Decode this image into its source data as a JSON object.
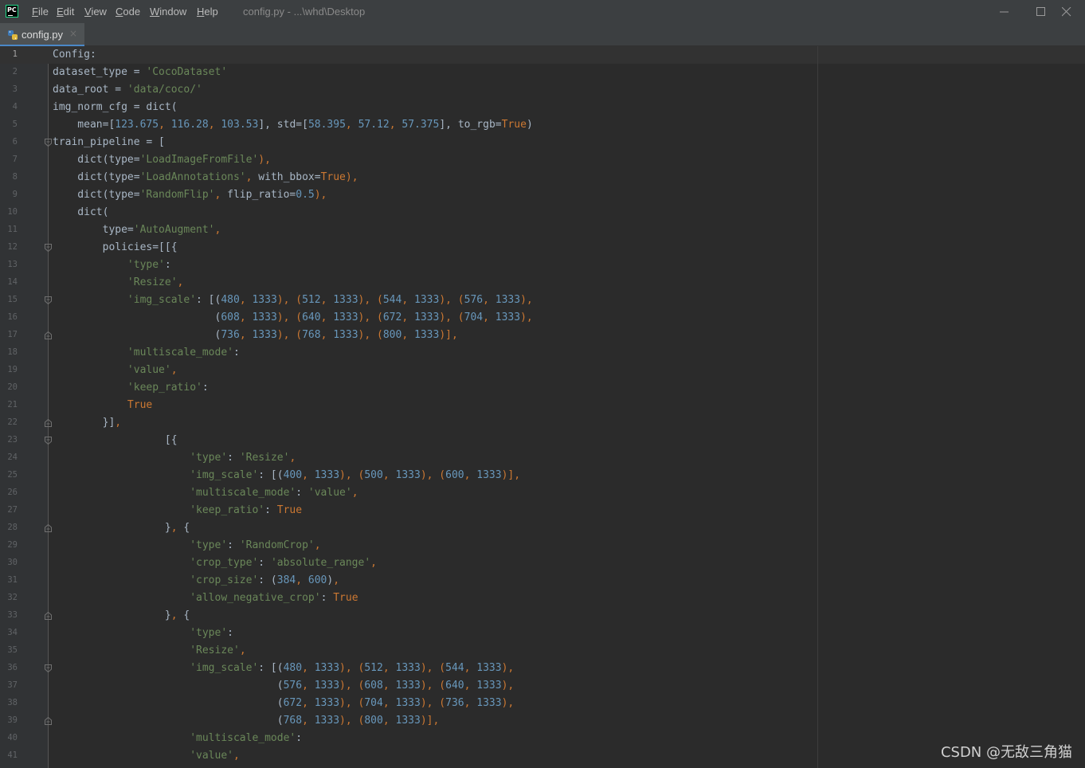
{
  "app": {
    "logo_text": "PC",
    "menu": [
      {
        "prefix": "",
        "accel": "F",
        "rest": "ile"
      },
      {
        "prefix": "",
        "accel": "E",
        "rest": "dit"
      },
      {
        "prefix": "",
        "accel": "V",
        "rest": "iew"
      },
      {
        "prefix": "",
        "accel": "C",
        "rest": "ode"
      },
      {
        "prefix": "",
        "accel": "W",
        "rest": "indow"
      },
      {
        "prefix": "",
        "accel": "H",
        "rest": "elp"
      }
    ],
    "window_title": "config.py - ...\\whd\\Desktop"
  },
  "tab": {
    "label": "config.py",
    "close_glyph": "×"
  },
  "editor": {
    "current_line": 1,
    "lines": [
      {
        "n": "1",
        "fold": "",
        "tokens": [
          [
            "Config:",
            ""
          ]
        ]
      },
      {
        "n": "2",
        "fold": "",
        "tokens": [
          [
            "dataset_type = ",
            ""
          ],
          [
            "'CocoDataset'",
            "s"
          ]
        ]
      },
      {
        "n": "3",
        "fold": "",
        "tokens": [
          [
            "data_root = ",
            ""
          ],
          [
            "'data/coco/'",
            "s"
          ]
        ]
      },
      {
        "n": "4",
        "fold": "",
        "tokens": [
          [
            "img_norm_cfg = dict(",
            ""
          ]
        ]
      },
      {
        "n": "5",
        "fold": "",
        "tokens": [
          [
            "    mean=[",
            ""
          ],
          [
            "123.675",
            "n"
          ],
          [
            ", ",
            "p"
          ],
          [
            "116.28",
            "n"
          ],
          [
            ", ",
            "p"
          ],
          [
            "103.53",
            "n"
          ],
          [
            "], std=[",
            ""
          ],
          [
            "58.395",
            "n"
          ],
          [
            ", ",
            "p"
          ],
          [
            "57.12",
            "n"
          ],
          [
            ", ",
            "p"
          ],
          [
            "57.375",
            "n"
          ],
          [
            "], to_rgb=",
            ""
          ],
          [
            "True",
            "k"
          ],
          [
            ")",
            ""
          ]
        ]
      },
      {
        "n": "6",
        "fold": "open",
        "tokens": [
          [
            "train_pipeline = [",
            ""
          ]
        ]
      },
      {
        "n": "7",
        "fold": "",
        "tokens": [
          [
            "    dict(type=",
            ""
          ],
          [
            "'LoadImageFromFile'",
            "s"
          ],
          [
            "),",
            "p"
          ]
        ]
      },
      {
        "n": "8",
        "fold": "",
        "tokens": [
          [
            "    dict(type=",
            ""
          ],
          [
            "'LoadAnnotations'",
            "s"
          ],
          [
            ", ",
            "p"
          ],
          [
            "with_bbox=",
            ""
          ],
          [
            "True",
            "k"
          ],
          [
            "),",
            "p"
          ]
        ]
      },
      {
        "n": "9",
        "fold": "",
        "tokens": [
          [
            "    dict(type=",
            ""
          ],
          [
            "'RandomFlip'",
            "s"
          ],
          [
            ", ",
            "p"
          ],
          [
            "flip_ratio=",
            ""
          ],
          [
            "0.5",
            "n"
          ],
          [
            "),",
            "p"
          ]
        ]
      },
      {
        "n": "10",
        "fold": "",
        "tokens": [
          [
            "    dict(",
            ""
          ]
        ]
      },
      {
        "n": "11",
        "fold": "",
        "tokens": [
          [
            "        type=",
            ""
          ],
          [
            "'AutoAugment'",
            "s"
          ],
          [
            ",",
            "p"
          ]
        ]
      },
      {
        "n": "12",
        "fold": "open",
        "tokens": [
          [
            "        policies=[[{",
            ""
          ]
        ]
      },
      {
        "n": "13",
        "fold": "",
        "tokens": [
          [
            "            ",
            ""
          ],
          [
            "'type'",
            "s"
          ],
          [
            ":",
            ""
          ]
        ]
      },
      {
        "n": "14",
        "fold": "",
        "tokens": [
          [
            "            ",
            ""
          ],
          [
            "'Resize'",
            "s"
          ],
          [
            ",",
            "p"
          ]
        ]
      },
      {
        "n": "15",
        "fold": "open",
        "tokens": [
          [
            "            ",
            ""
          ],
          [
            "'img_scale'",
            "s"
          ],
          [
            ": [(",
            ""
          ],
          [
            "480",
            "n"
          ],
          [
            ", ",
            "p"
          ],
          [
            "1333",
            "n"
          ],
          [
            "), (",
            "p"
          ],
          [
            "512",
            "n"
          ],
          [
            ", ",
            "p"
          ],
          [
            "1333",
            "n"
          ],
          [
            "), (",
            "p"
          ],
          [
            "544",
            "n"
          ],
          [
            ", ",
            "p"
          ],
          [
            "1333",
            "n"
          ],
          [
            "), (",
            "p"
          ],
          [
            "576",
            "n"
          ],
          [
            ", ",
            "p"
          ],
          [
            "1333",
            "n"
          ],
          [
            "),",
            "p"
          ]
        ]
      },
      {
        "n": "16",
        "fold": "",
        "tokens": [
          [
            "                          (",
            ""
          ],
          [
            "608",
            "n"
          ],
          [
            ", ",
            "p"
          ],
          [
            "1333",
            "n"
          ],
          [
            "), (",
            "p"
          ],
          [
            "640",
            "n"
          ],
          [
            ", ",
            "p"
          ],
          [
            "1333",
            "n"
          ],
          [
            "), (",
            "p"
          ],
          [
            "672",
            "n"
          ],
          [
            ", ",
            "p"
          ],
          [
            "1333",
            "n"
          ],
          [
            "), (",
            "p"
          ],
          [
            "704",
            "n"
          ],
          [
            ", ",
            "p"
          ],
          [
            "1333",
            "n"
          ],
          [
            "),",
            "p"
          ]
        ]
      },
      {
        "n": "17",
        "fold": "close",
        "tokens": [
          [
            "                          (",
            ""
          ],
          [
            "736",
            "n"
          ],
          [
            ", ",
            "p"
          ],
          [
            "1333",
            "n"
          ],
          [
            "), (",
            "p"
          ],
          [
            "768",
            "n"
          ],
          [
            ", ",
            "p"
          ],
          [
            "1333",
            "n"
          ],
          [
            "), (",
            "p"
          ],
          [
            "800",
            "n"
          ],
          [
            ", ",
            "p"
          ],
          [
            "1333",
            "n"
          ],
          [
            ")],",
            "p"
          ]
        ]
      },
      {
        "n": "18",
        "fold": "",
        "tokens": [
          [
            "            ",
            ""
          ],
          [
            "'multiscale_mode'",
            "s"
          ],
          [
            ":",
            ""
          ]
        ]
      },
      {
        "n": "19",
        "fold": "",
        "tokens": [
          [
            "            ",
            ""
          ],
          [
            "'value'",
            "s"
          ],
          [
            ",",
            "p"
          ]
        ]
      },
      {
        "n": "20",
        "fold": "",
        "tokens": [
          [
            "            ",
            ""
          ],
          [
            "'keep_ratio'",
            "s"
          ],
          [
            ":",
            ""
          ]
        ]
      },
      {
        "n": "21",
        "fold": "",
        "tokens": [
          [
            "            ",
            ""
          ],
          [
            "True",
            "k"
          ]
        ]
      },
      {
        "n": "22",
        "fold": "close",
        "tokens": [
          [
            "        }]",
            ""
          ],
          [
            ",",
            "p"
          ]
        ]
      },
      {
        "n": "23",
        "fold": "open",
        "tokens": [
          [
            "                  [{",
            ""
          ]
        ]
      },
      {
        "n": "24",
        "fold": "",
        "tokens": [
          [
            "                      ",
            ""
          ],
          [
            "'type'",
            "s"
          ],
          [
            ": ",
            ""
          ],
          [
            "'Resize'",
            "s"
          ],
          [
            ",",
            "p"
          ]
        ]
      },
      {
        "n": "25",
        "fold": "",
        "tokens": [
          [
            "                      ",
            ""
          ],
          [
            "'img_scale'",
            "s"
          ],
          [
            ": [(",
            ""
          ],
          [
            "400",
            "n"
          ],
          [
            ", ",
            "p"
          ],
          [
            "1333",
            "n"
          ],
          [
            "), (",
            "p"
          ],
          [
            "500",
            "n"
          ],
          [
            ", ",
            "p"
          ],
          [
            "1333",
            "n"
          ],
          [
            "), (",
            "p"
          ],
          [
            "600",
            "n"
          ],
          [
            ", ",
            "p"
          ],
          [
            "1333",
            "n"
          ],
          [
            ")],",
            "p"
          ]
        ]
      },
      {
        "n": "26",
        "fold": "",
        "tokens": [
          [
            "                      ",
            ""
          ],
          [
            "'multiscale_mode'",
            "s"
          ],
          [
            ": ",
            ""
          ],
          [
            "'value'",
            "s"
          ],
          [
            ",",
            "p"
          ]
        ]
      },
      {
        "n": "27",
        "fold": "",
        "tokens": [
          [
            "                      ",
            ""
          ],
          [
            "'keep_ratio'",
            "s"
          ],
          [
            ": ",
            ""
          ],
          [
            "True",
            "k"
          ]
        ]
      },
      {
        "n": "28",
        "fold": "close",
        "tokens": [
          [
            "                  }",
            ""
          ],
          [
            ", ",
            "p"
          ],
          [
            "{",
            ""
          ]
        ]
      },
      {
        "n": "29",
        "fold": "",
        "tokens": [
          [
            "                      ",
            ""
          ],
          [
            "'type'",
            "s"
          ],
          [
            ": ",
            ""
          ],
          [
            "'RandomCrop'",
            "s"
          ],
          [
            ",",
            "p"
          ]
        ]
      },
      {
        "n": "30",
        "fold": "",
        "tokens": [
          [
            "                      ",
            ""
          ],
          [
            "'crop_type'",
            "s"
          ],
          [
            ": ",
            ""
          ],
          [
            "'absolute_range'",
            "s"
          ],
          [
            ",",
            "p"
          ]
        ]
      },
      {
        "n": "31",
        "fold": "",
        "tokens": [
          [
            "                      ",
            ""
          ],
          [
            "'crop_size'",
            "s"
          ],
          [
            ": (",
            ""
          ],
          [
            "384",
            "n"
          ],
          [
            ", ",
            "p"
          ],
          [
            "600",
            "n"
          ],
          [
            ")",
            ""
          ],
          [
            ",",
            "p"
          ]
        ]
      },
      {
        "n": "32",
        "fold": "",
        "tokens": [
          [
            "                      ",
            ""
          ],
          [
            "'allow_negative_crop'",
            "s"
          ],
          [
            ": ",
            ""
          ],
          [
            "True",
            "k"
          ]
        ]
      },
      {
        "n": "33",
        "fold": "close",
        "tokens": [
          [
            "                  }",
            ""
          ],
          [
            ", ",
            "p"
          ],
          [
            "{",
            ""
          ]
        ]
      },
      {
        "n": "34",
        "fold": "",
        "tokens": [
          [
            "                      ",
            ""
          ],
          [
            "'type'",
            "s"
          ],
          [
            ":",
            ""
          ]
        ]
      },
      {
        "n": "35",
        "fold": "",
        "tokens": [
          [
            "                      ",
            ""
          ],
          [
            "'Resize'",
            "s"
          ],
          [
            ",",
            "p"
          ]
        ]
      },
      {
        "n": "36",
        "fold": "open",
        "tokens": [
          [
            "                      ",
            ""
          ],
          [
            "'img_scale'",
            "s"
          ],
          [
            ": [(",
            ""
          ],
          [
            "480",
            "n"
          ],
          [
            ", ",
            "p"
          ],
          [
            "1333",
            "n"
          ],
          [
            "), (",
            "p"
          ],
          [
            "512",
            "n"
          ],
          [
            ", ",
            "p"
          ],
          [
            "1333",
            "n"
          ],
          [
            "), (",
            "p"
          ],
          [
            "544",
            "n"
          ],
          [
            ", ",
            "p"
          ],
          [
            "1333",
            "n"
          ],
          [
            "),",
            "p"
          ]
        ]
      },
      {
        "n": "37",
        "fold": "",
        "tokens": [
          [
            "                                    (",
            ""
          ],
          [
            "576",
            "n"
          ],
          [
            ", ",
            "p"
          ],
          [
            "1333",
            "n"
          ],
          [
            "), (",
            "p"
          ],
          [
            "608",
            "n"
          ],
          [
            ", ",
            "p"
          ],
          [
            "1333",
            "n"
          ],
          [
            "), (",
            "p"
          ],
          [
            "640",
            "n"
          ],
          [
            ", ",
            "p"
          ],
          [
            "1333",
            "n"
          ],
          [
            "),",
            "p"
          ]
        ]
      },
      {
        "n": "38",
        "fold": "",
        "tokens": [
          [
            "                                    (",
            ""
          ],
          [
            "672",
            "n"
          ],
          [
            ", ",
            "p"
          ],
          [
            "1333",
            "n"
          ],
          [
            "), (",
            "p"
          ],
          [
            "704",
            "n"
          ],
          [
            ", ",
            "p"
          ],
          [
            "1333",
            "n"
          ],
          [
            "), (",
            "p"
          ],
          [
            "736",
            "n"
          ],
          [
            ", ",
            "p"
          ],
          [
            "1333",
            "n"
          ],
          [
            "),",
            "p"
          ]
        ]
      },
      {
        "n": "39",
        "fold": "close",
        "tokens": [
          [
            "                                    (",
            ""
          ],
          [
            "768",
            "n"
          ],
          [
            ", ",
            "p"
          ],
          [
            "1333",
            "n"
          ],
          [
            "), (",
            "p"
          ],
          [
            "800",
            "n"
          ],
          [
            ", ",
            "p"
          ],
          [
            "1333",
            "n"
          ],
          [
            ")],",
            "p"
          ]
        ]
      },
      {
        "n": "40",
        "fold": "",
        "tokens": [
          [
            "                      ",
            ""
          ],
          [
            "'multiscale_mode'",
            "s"
          ],
          [
            ":",
            ""
          ]
        ]
      },
      {
        "n": "41",
        "fold": "",
        "tokens": [
          [
            "                      ",
            ""
          ],
          [
            "'value'",
            "s"
          ],
          [
            ",",
            "p"
          ]
        ]
      }
    ]
  },
  "watermark": "CSDN @无敌三角猫",
  "colors": {
    "background": "#2b2b2b",
    "chrome": "#3c3f41",
    "gutter": "#313335",
    "default_text": "#a9b7c6",
    "string": "#6a8759",
    "number": "#6897bb",
    "keyword": "#cc7832",
    "line_number": "#606366"
  },
  "icons": {
    "logo": "pycharm-logo-icon",
    "tab": "python-file-icon",
    "minimize": "minimize-icon",
    "maximize": "maximize-icon",
    "close": "close-icon",
    "fold_open": "fold-open-icon",
    "fold_close": "fold-close-icon"
  }
}
